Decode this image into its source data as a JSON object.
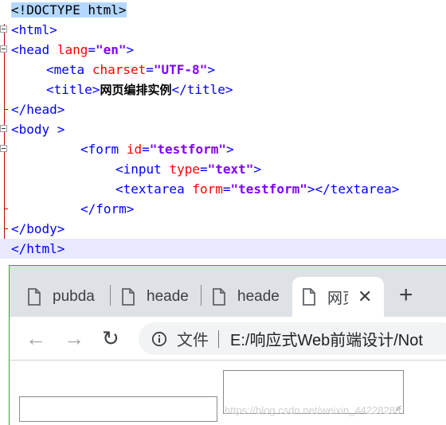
{
  "editor": {
    "doctype": "<!DOCTYPE html>",
    "html_open": "<html>",
    "head_open_tag": "<head",
    "lang_attr": "lang",
    "lang_value": "\"en\"",
    "tag_close": ">",
    "meta_tag": "<meta",
    "charset_attr": "charset",
    "charset_value": "\"UTF-8\"",
    "title_open": "<title>",
    "title_text": "网页编排实例",
    "title_close": "</title>",
    "head_close": "</head>",
    "body_open": "<body >",
    "form_tag": "<form",
    "id_attr": "id",
    "id_value": "\"testform\"",
    "input_tag": "<input",
    "type_attr": "type",
    "type_value": "\"text\"",
    "textarea_tag": "<textarea",
    "form_attr": "form",
    "form_value": "\"testform\"",
    "textarea_end": "></textarea>",
    "form_close": "</form>",
    "body_close": "</body>",
    "html_close": "</html>"
  },
  "browser": {
    "tabs": [
      {
        "label": "pubda"
      },
      {
        "label": "heade"
      },
      {
        "label": "heade"
      },
      {
        "label": "网页",
        "active": true
      }
    ],
    "new_tab_label": "+",
    "close_label": "✕",
    "back_label": "←",
    "forward_label": "→",
    "reload_label": "↻",
    "address": {
      "label": "文件",
      "url": "E:/响应式Web前端设计/Not"
    },
    "watermark": "https://blog.csdn.net/weixin_44228283"
  }
}
